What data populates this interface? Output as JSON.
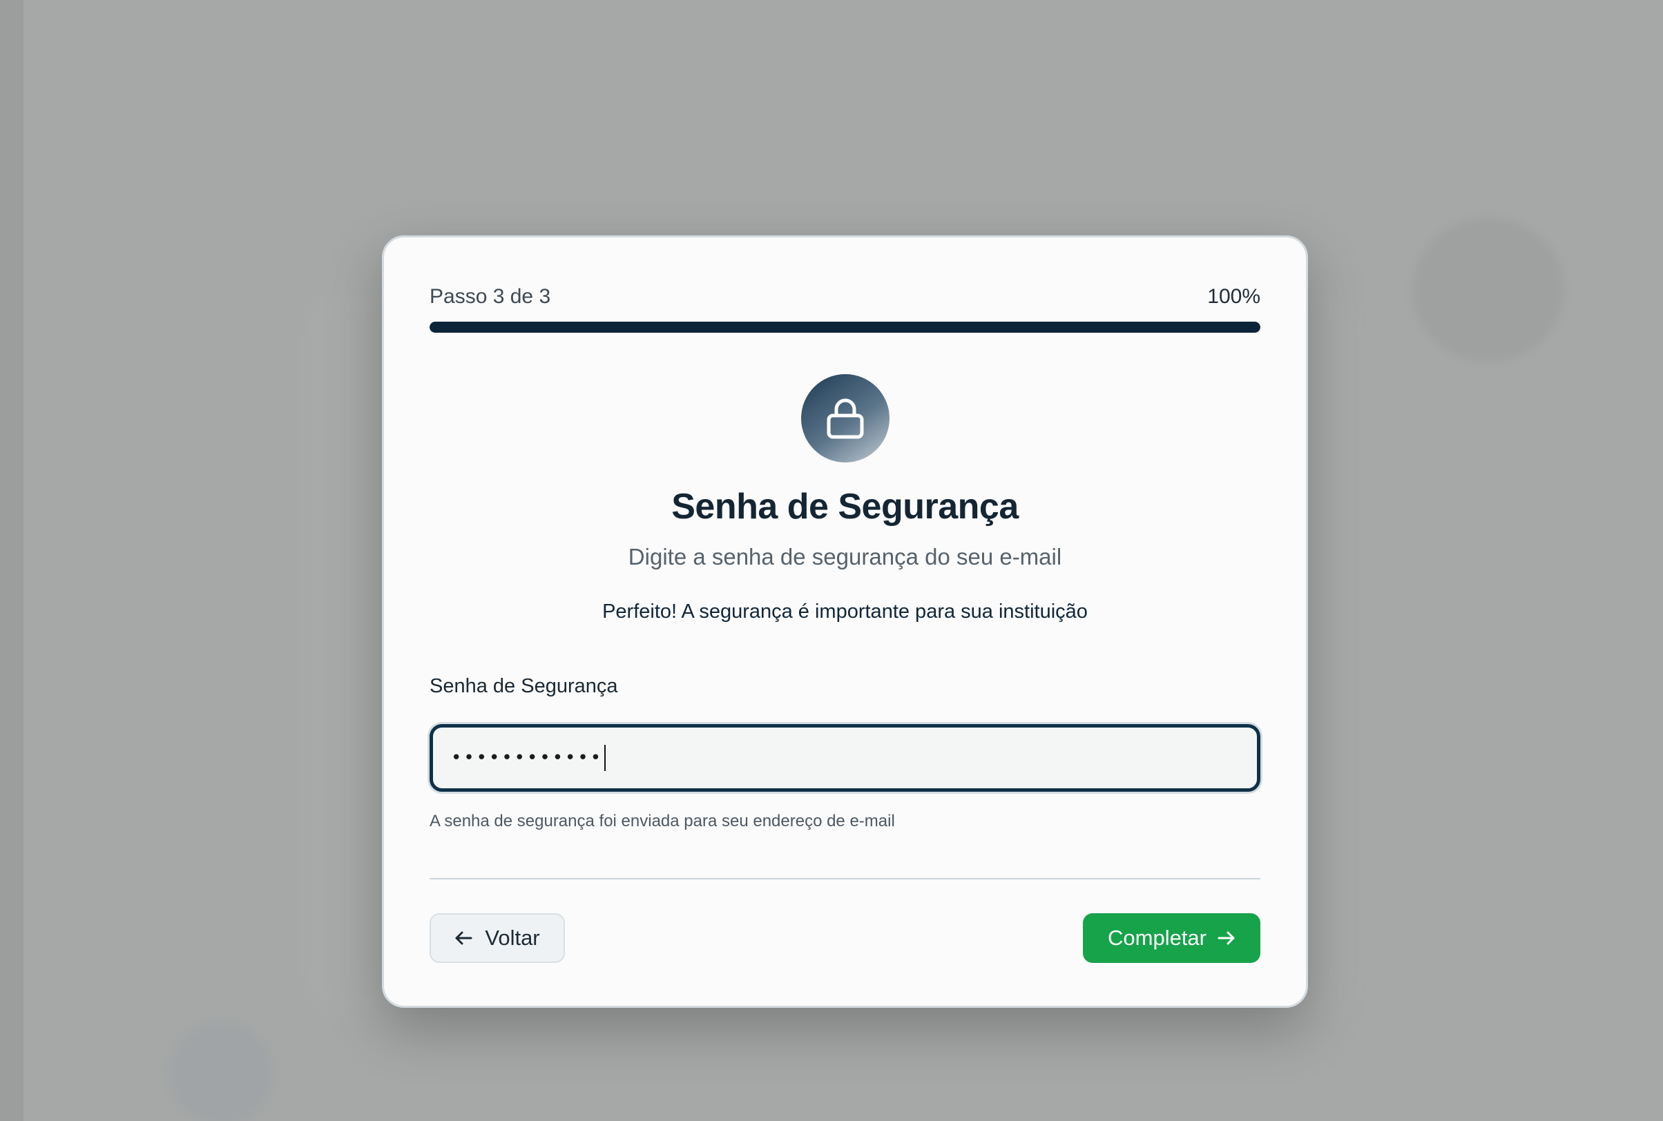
{
  "wizard": {
    "step_label": "Passo 3 de 3",
    "progress_label": "100%",
    "progress_fraction": 1.0
  },
  "header": {
    "icon": "lock-icon",
    "title": "Senha de Segurança",
    "subtitle": "Digite a senha de segurança do seu e-mail",
    "note": "Perfeito! A segurança é importante para sua instituição"
  },
  "form": {
    "password_label": "Senha de Segurança",
    "password_value": "••••••••••••",
    "helper_text": "A senha de segurança foi enviada para seu endereço de e-mail"
  },
  "actions": {
    "back_label": "Voltar",
    "back_icon": "arrow-left-icon",
    "complete_label": "Completar",
    "complete_icon": "arrow-right-icon"
  },
  "colors": {
    "primary_dark": "#0c2438",
    "success": "#16a34a"
  }
}
